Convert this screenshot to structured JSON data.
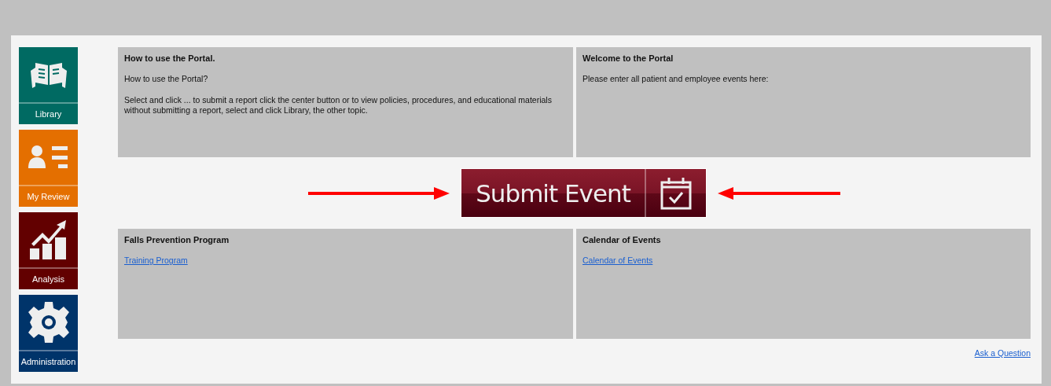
{
  "sidebar": {
    "items": [
      {
        "label": "Library",
        "color": "#006a62"
      },
      {
        "label": "My Review",
        "color": "#e46f00"
      },
      {
        "label": "Analysis",
        "color": "#620000"
      },
      {
        "label": "Administration",
        "color": "#00346a"
      }
    ]
  },
  "panels": [
    {
      "title": "How to use the Portal.",
      "texts": [
        "How to use the Portal?",
        "Select and click ... to submit a report click the center button or to view policies, procedures, and educational materials without submitting a report, select and click Library, the other topic."
      ]
    },
    {
      "title": "Welcome to the Portal",
      "texts": [
        "Please enter all patient and employee events here:"
      ]
    },
    {
      "title": "Falls Prevention Program",
      "links": [
        "Training Program"
      ]
    },
    {
      "title": "Calendar of Events",
      "links": [
        "Calendar of Events"
      ]
    }
  ],
  "submit_button": {
    "label": "Submit Event"
  },
  "footer_link": "Ask a Question"
}
